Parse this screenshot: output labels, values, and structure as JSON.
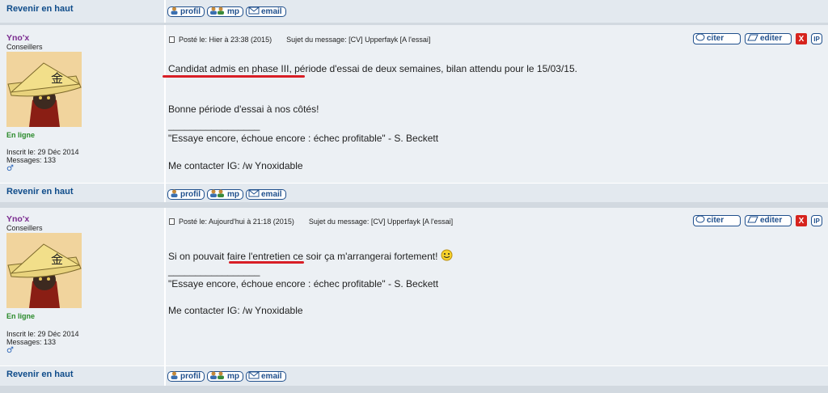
{
  "top_row": {
    "back_to_top": "Revenir en haut",
    "buttons": {
      "profil": "profil",
      "mp": "mp",
      "email": "email"
    }
  },
  "posts": [
    {
      "author": "Yno'x",
      "rank": "Conseillers",
      "status": "En ligne",
      "joined": "Inscrit le: 29 Déc 2014",
      "messages": "Messages: 133",
      "gender_symbol": "♂",
      "posted": "Posté le: Hier à 23:38 (2015)",
      "subject": "Sujet du message: [CV] Upperfayk [A l'essai]",
      "actions": {
        "quote": "citer",
        "edit": "editer",
        "delete": "X",
        "ip": "IP"
      },
      "lines": {
        "l1_underlined": "Candidat admis en phase III",
        "l1_rest": ", période d'essai de deux semaines, bilan attendu pour le 15/03/15.",
        "l2": "Bonne période d'essai à nos côtés!",
        "separator": "_________________",
        "quote": "\"Essaye encore, échoue encore : échec profitable\" - S. Beckett",
        "contact": "Me contacter IG: /w Ynoxidable"
      },
      "back_to_top": "Revenir en haut",
      "buttons": {
        "profil": "profil",
        "mp": "mp",
        "email": "email"
      }
    },
    {
      "author": "Yno'x",
      "rank": "Conseillers",
      "status": "En ligne",
      "joined": "Inscrit le: 29 Déc 2014",
      "messages": "Messages: 133",
      "gender_symbol": "♂",
      "posted": "Posté le: Aujourd'hui à 21:18 (2015)",
      "subject": "Sujet du message: [CV] Upperfayk [A l'essai]",
      "actions": {
        "quote": "citer",
        "edit": "editer",
        "delete": "X",
        "ip": "IP"
      },
      "lines": {
        "l1_pre": "Si on pouvait ",
        "l1_underlined": "faire l'entretien",
        "l1_rest": " ce soir ça m'arrangerai fortement!",
        "separator": "_________________",
        "quote": "\"Essaye encore, échoue encore : échec profitable\" - S. Beckett",
        "contact": "Me contacter IG: /w Ynoxidable"
      },
      "back_to_top": "Revenir en haut",
      "buttons": {
        "profil": "profil",
        "mp": "mp",
        "email": "email"
      }
    }
  ]
}
